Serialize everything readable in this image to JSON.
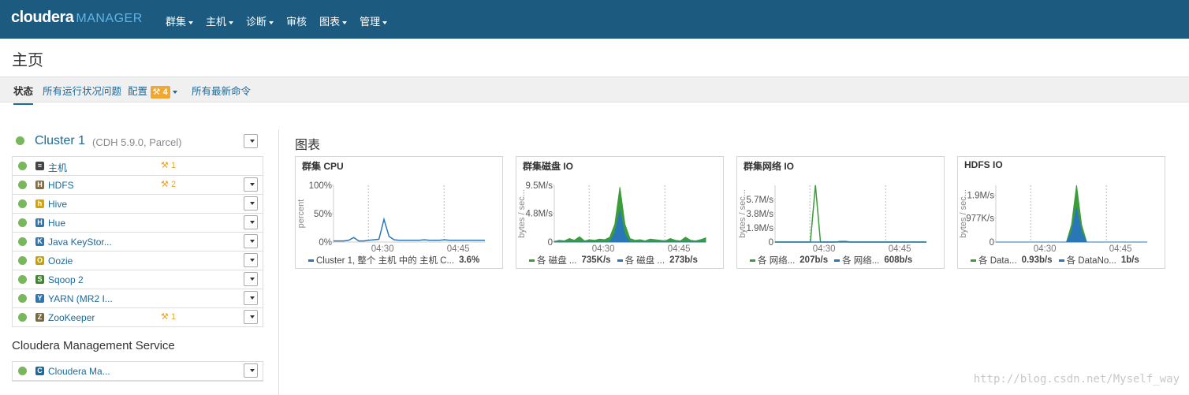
{
  "header": {
    "logo_main": "cloudera",
    "logo_sub": "MANAGER",
    "nav": [
      {
        "label": "群集",
        "dropdown": true
      },
      {
        "label": "主机",
        "dropdown": true
      },
      {
        "label": "诊断",
        "dropdown": true
      },
      {
        "label": "审核",
        "dropdown": false
      },
      {
        "label": "图表",
        "dropdown": true
      },
      {
        "label": "管理",
        "dropdown": true
      }
    ]
  },
  "page": {
    "title": "主页"
  },
  "subnav": {
    "status": "状态",
    "issues": "所有运行状况问题",
    "config": "配置",
    "config_badge": "4",
    "commands": "所有最新命令"
  },
  "cluster": {
    "name": "Cluster 1",
    "version": "(CDH 5.9.0, Parcel)",
    "services": [
      {
        "name": "主机",
        "icon": "hosts-icon",
        "warn": "1",
        "menu": false
      },
      {
        "name": "HDFS",
        "icon": "hdfs-icon",
        "warn": "2",
        "menu": true
      },
      {
        "name": "Hive",
        "icon": "hive-icon",
        "warn": "",
        "menu": true
      },
      {
        "name": "Hue",
        "icon": "hue-icon",
        "warn": "",
        "menu": true
      },
      {
        "name": "Java KeyStor...",
        "icon": "keystore-icon",
        "warn": "",
        "menu": true
      },
      {
        "name": "Oozie",
        "icon": "oozie-icon",
        "warn": "",
        "menu": true
      },
      {
        "name": "Sqoop 2",
        "icon": "sqoop-icon",
        "warn": "",
        "menu": true
      },
      {
        "name": "YARN (MR2 I...",
        "icon": "yarn-icon",
        "warn": "",
        "menu": true
      },
      {
        "name": "ZooKeeper",
        "icon": "zookeeper-icon",
        "warn": "1",
        "menu": true
      }
    ]
  },
  "management": {
    "title": "Cloudera Management Service",
    "service": "Cloudera Ma..."
  },
  "charts_title": "图表",
  "colors": {
    "green": "#3a9d3a",
    "blue": "#2a77b8",
    "status": "#77b85a",
    "warn": "#e8a42f"
  },
  "chart_data": [
    {
      "type": "line",
      "title": "群集 CPU",
      "ylabel": "percent",
      "yticks": [
        "100%",
        "50%",
        "0%"
      ],
      "xticks": [
        "04:30",
        "04:45"
      ],
      "ylim": [
        0,
        100
      ],
      "x": [
        0,
        1,
        2,
        3,
        4,
        5,
        6,
        7,
        8,
        9,
        10,
        11,
        12,
        13,
        14,
        15,
        16,
        17,
        18,
        19,
        20,
        21,
        22,
        23,
        24,
        25,
        26,
        27,
        28,
        29,
        30
      ],
      "series": [
        {
          "name": "Cluster 1, 整个 主机 中的 主机 C...",
          "value": "3.6%",
          "color": "#2a77b8",
          "values": [
            2,
            2,
            2,
            3,
            8,
            2,
            2,
            3,
            4,
            5,
            40,
            10,
            4,
            3,
            3,
            3,
            3,
            3,
            4,
            3,
            3,
            3,
            4,
            3,
            3,
            3,
            3,
            3,
            3,
            3,
            3
          ]
        }
      ]
    },
    {
      "type": "area",
      "title": "群集磁盘 IO",
      "ylabel": "bytes / sec...",
      "yticks": [
        "9.5M/s",
        "4.8M/s",
        "0"
      ],
      "xticks": [
        "04:30",
        "04:45"
      ],
      "ylim": [
        0,
        9.5
      ],
      "x": [
        0,
        1,
        2,
        3,
        4,
        5,
        6,
        7,
        8,
        9,
        10,
        11,
        12,
        13,
        14,
        15,
        16,
        17,
        18,
        19,
        20,
        21,
        22,
        23,
        24,
        25,
        26,
        27,
        28,
        29,
        30
      ],
      "series": [
        {
          "name": "各 磁盘 ...",
          "value": "735K/s",
          "color": "#3a9d3a",
          "values": [
            0.1,
            0.3,
            0.2,
            0.6,
            0.3,
            0.9,
            0.2,
            0.4,
            0.3,
            0.5,
            0.4,
            0.8,
            3,
            9.2,
            3,
            0.6,
            0.3,
            0.4,
            0.2,
            0.5,
            0.4,
            0.3,
            0.2,
            0.6,
            0.3,
            0.2,
            0.8,
            0.3,
            0.2,
            0.4,
            0.7
          ]
        },
        {
          "name": "各 磁盘 ...",
          "value": "273b/s",
          "color": "#2a77b8",
          "values": [
            0,
            0,
            0,
            0,
            0,
            0,
            0,
            0,
            0,
            0,
            0,
            0,
            1.5,
            5.2,
            1.2,
            0,
            0,
            0,
            0,
            0,
            0,
            0,
            0,
            0,
            0,
            0,
            0,
            0,
            0,
            0,
            0
          ]
        }
      ]
    },
    {
      "type": "line",
      "title": "群集网络 IO",
      "ylabel": "bytes / sec...",
      "yticks": [
        "5.7M/s",
        "3.8M/s",
        "1.9M/s",
        "0"
      ],
      "xticks": [
        "04:30",
        "04:45"
      ],
      "ylim": [
        0,
        7.6
      ],
      "x": [
        0,
        1,
        2,
        3,
        4,
        5,
        6,
        7,
        8,
        9,
        10,
        11,
        12,
        13,
        14,
        15,
        16,
        17,
        18,
        19,
        20,
        21,
        22,
        23,
        24,
        25,
        26,
        27,
        28,
        29,
        30
      ],
      "series": [
        {
          "name": "各 网络...",
          "value": "207b/s",
          "color": "#3a9d3a",
          "values": [
            0,
            0,
            0,
            0,
            0,
            0,
            0,
            0,
            7.6,
            0,
            0,
            0,
            0,
            0.1,
            0.1,
            0,
            0,
            0,
            0,
            0,
            0,
            0,
            0,
            0,
            0,
            0,
            0,
            0,
            0,
            0,
            0
          ]
        },
        {
          "name": "各 网络...",
          "value": "608b/s",
          "color": "#2a77b8",
          "values": [
            0,
            0,
            0,
            0,
            0,
            0,
            0,
            0,
            0,
            0,
            0,
            0,
            0,
            0,
            0,
            0,
            0,
            0,
            0,
            0,
            0,
            0,
            0,
            0,
            0,
            0,
            0,
            0,
            0,
            0,
            0
          ]
        }
      ]
    },
    {
      "type": "area",
      "title": "HDFS IO",
      "ylabel": "bytes / sec...",
      "yticks": [
        "1.9M/s",
        "977K/s",
        "0"
      ],
      "xticks": [
        "04:30",
        "04:45"
      ],
      "ylim": [
        0,
        2.3
      ],
      "x": [
        0,
        1,
        2,
        3,
        4,
        5,
        6,
        7,
        8,
        9,
        10,
        11,
        12,
        13,
        14,
        15,
        16,
        17,
        18,
        19,
        20,
        21,
        22,
        23,
        24,
        25,
        26,
        27,
        28,
        29,
        30
      ],
      "series": [
        {
          "name": "各 Data...",
          "value": "0.93b/s",
          "color": "#3a9d3a",
          "values": [
            0,
            0,
            0,
            0,
            0,
            0,
            0,
            0,
            0,
            0,
            0,
            0,
            0,
            0,
            0,
            0.7,
            2.3,
            0.7,
            0,
            0,
            0,
            0,
            0,
            0,
            0,
            0,
            0,
            0,
            0,
            0,
            0
          ]
        },
        {
          "name": "各 DataNo...",
          "value": "1b/s",
          "color": "#2a77b8",
          "values": [
            0,
            0,
            0,
            0,
            0,
            0,
            0,
            0,
            0,
            0,
            0,
            0,
            0,
            0,
            0,
            0.4,
            1.4,
            0.4,
            0,
            0,
            0,
            0,
            0,
            0,
            0,
            0,
            0,
            0,
            0,
            0,
            0
          ]
        }
      ]
    }
  ],
  "watermark": "http://blog.csdn.net/Myself_way"
}
